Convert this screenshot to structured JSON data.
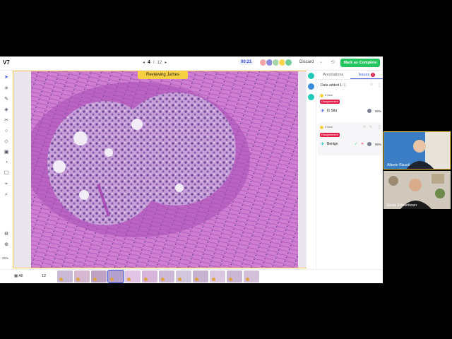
{
  "app": {
    "logo": "V7",
    "pager": {
      "prev": "◂",
      "current": "4",
      "separator": "/",
      "total": "12",
      "next": "▸"
    },
    "timer": "00:21",
    "discard_label": "Discard",
    "chevron": "⌄",
    "redo_icon": "⟲",
    "complete_label": "Mark as Complete",
    "review_banner": "Reviewing James",
    "zoom": "25%"
  },
  "avatars": [
    {
      "color": "#f4a6a6"
    },
    {
      "color": "#8c8cdc"
    },
    {
      "color": "#a5d6a7"
    },
    {
      "color": "#ffd54f"
    },
    {
      "color": "#6fcf97"
    }
  ],
  "toolbar": {
    "items": [
      "➤",
      "✳",
      "✎",
      "◈",
      "✂",
      "○",
      "◇",
      "▣",
      "◔",
      "☐",
      "⌖",
      "⌕"
    ],
    "bottom": [
      "⚙",
      "⊕"
    ]
  },
  "rail": {
    "colors": [
      "#22c9b5",
      "#3a8ddc",
      "#22c9b5"
    ]
  },
  "panel": {
    "tabs": {
      "annotations": "Annotations",
      "issues": "Issues",
      "issues_count": "1"
    },
    "data_added": "Data added 1 ⓘ",
    "cards": [
      {
        "tag": "# New",
        "status": "Disagreement",
        "class": "In Situ",
        "pct": "96%"
      },
      {
        "tag": "# New",
        "status": "Disagreement",
        "class": "Benign",
        "pct": "96%"
      }
    ],
    "accept_icon": "✓",
    "reject_icon": "✕"
  },
  "filmstrip": {
    "all_label": "All",
    "count": "12",
    "thumbs": [
      {
        "color": "#c9b9d6"
      },
      {
        "color": "#d5b7cf"
      },
      {
        "color": "#bfa3c4"
      },
      {
        "color": "#b4a1d0"
      },
      {
        "color": "#e2c4e6"
      },
      {
        "color": "#d8b3da"
      },
      {
        "color": "#cdb8d6"
      },
      {
        "color": "#d1c6de"
      },
      {
        "color": "#c7b2cf"
      },
      {
        "color": "#dbc7df"
      },
      {
        "color": "#cbb6d3"
      },
      {
        "color": "#d4c0da"
      }
    ]
  },
  "videos": [
    {
      "name": "Alberto Rizzoli"
    },
    {
      "name": "Simon Edwardsson"
    }
  ]
}
